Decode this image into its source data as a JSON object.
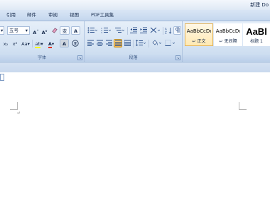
{
  "title_bar": {
    "title": "新建 Do"
  },
  "tabs": [
    "引用",
    "邮件",
    "审阅",
    "视图",
    "PDF工具集"
  ],
  "font_group": {
    "font_size": "五号",
    "grow_font": "A",
    "shrink_font": "A",
    "clear_format": "ʼ",
    "phonetic": "变",
    "char_border": "A",
    "subscript": "x₂",
    "superscript": "x²",
    "change_case": "Aa",
    "highlight": "ab",
    "font_color": "A",
    "char_shading": "A",
    "enclose_char": "字",
    "label": "字体"
  },
  "paragraph_group": {
    "label": "段落"
  },
  "styles_group": {
    "styles": [
      {
        "sample": "AaBbCcDı",
        "name": "↵ 正文"
      },
      {
        "sample": "AaBbCcDı",
        "name": "↵ 无间隔"
      },
      {
        "sample": "AaBl",
        "name": "标题 1"
      }
    ]
  },
  "colors": {
    "highlight": "#ffff00",
    "font_color": "#e03020",
    "active_style": "#e3b45a"
  }
}
